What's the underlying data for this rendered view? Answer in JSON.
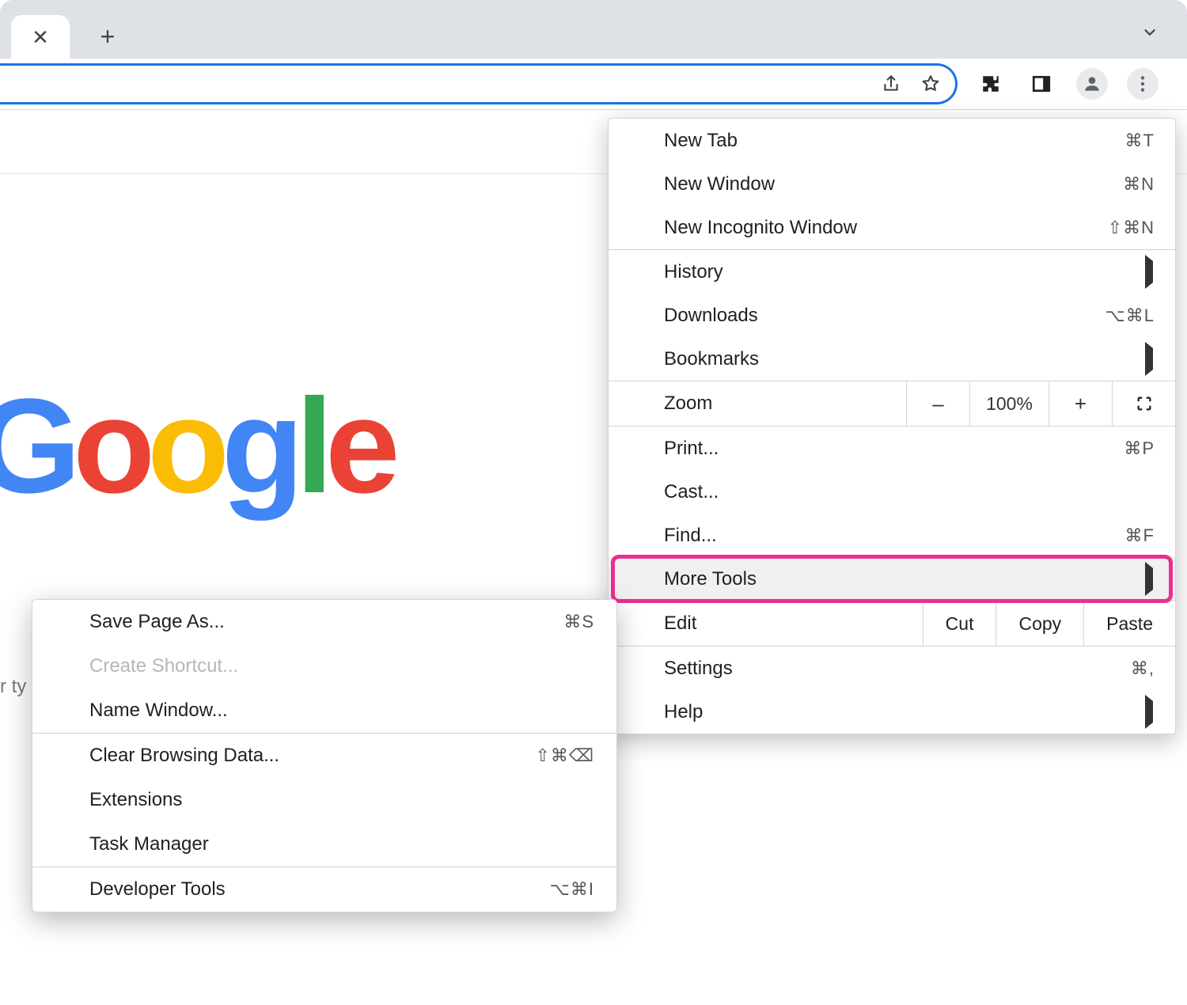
{
  "logo": {
    "letters": [
      "G",
      "o",
      "o",
      "g",
      "l",
      "e"
    ]
  },
  "search_partial_text": "r ty",
  "toolbar_icons": {
    "share": "share-icon",
    "star": "star-icon",
    "extensions": "puzzle-icon",
    "sidepanel": "sidepanel-icon",
    "profile": "profile-icon",
    "menu": "more-vert-icon"
  },
  "main_menu": {
    "items": [
      {
        "label": "New Tab",
        "shortcut": "⌘T"
      },
      {
        "label": "New Window",
        "shortcut": "⌘N"
      },
      {
        "label": "New Incognito Window",
        "shortcut": "⇧⌘N"
      }
    ],
    "history": {
      "label": "History"
    },
    "downloads": {
      "label": "Downloads",
      "shortcut": "⌥⌘L"
    },
    "bookmarks": {
      "label": "Bookmarks"
    },
    "zoom": {
      "label": "Zoom",
      "minus": "–",
      "value": "100%",
      "plus": "+"
    },
    "print": {
      "label": "Print...",
      "shortcut": "⌘P"
    },
    "cast": {
      "label": "Cast..."
    },
    "find": {
      "label": "Find...",
      "shortcut": "⌘F"
    },
    "more_tools": {
      "label": "More Tools"
    },
    "edit": {
      "label": "Edit",
      "cut": "Cut",
      "copy": "Copy",
      "paste": "Paste"
    },
    "settings": {
      "label": "Settings",
      "shortcut": "⌘,"
    },
    "help": {
      "label": "Help"
    }
  },
  "submenu": {
    "save_page": {
      "label": "Save Page As...",
      "shortcut": "⌘S"
    },
    "create_shortcut": {
      "label": "Create Shortcut..."
    },
    "name_window": {
      "label": "Name Window..."
    },
    "clear_browsing": {
      "label": "Clear Browsing Data...",
      "shortcut": "⇧⌘⌫"
    },
    "extensions": {
      "label": "Extensions"
    },
    "task_manager": {
      "label": "Task Manager"
    },
    "dev_tools": {
      "label": "Developer Tools",
      "shortcut": "⌥⌘I"
    }
  }
}
